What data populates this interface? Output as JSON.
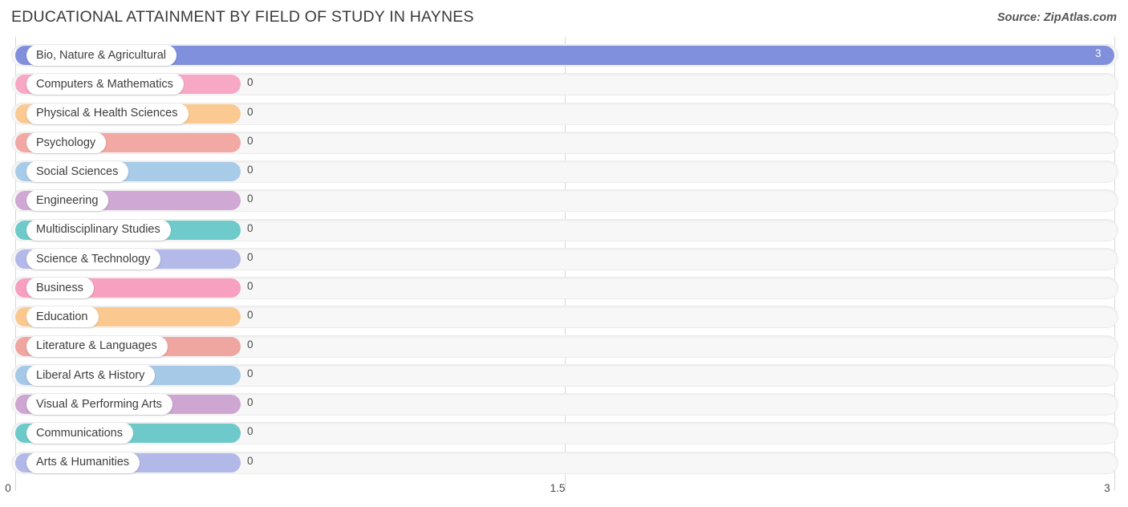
{
  "header": {
    "title": "EDUCATIONAL ATTAINMENT BY FIELD OF STUDY IN HAYNES",
    "source": "Source: ZipAtlas.com"
  },
  "chart_data": {
    "type": "bar",
    "orientation": "horizontal",
    "title": "EDUCATIONAL ATTAINMENT BY FIELD OF STUDY IN HAYNES",
    "xlabel": "",
    "ylabel": "",
    "xlim": [
      0,
      3
    ],
    "grid": true,
    "legend": "none",
    "xticks": [
      "0",
      "1.5",
      "3"
    ],
    "xtick_values": [
      0,
      1.5,
      3
    ],
    "categories": [
      "Bio, Nature & Agricultural",
      "Computers & Mathematics",
      "Physical & Health Sciences",
      "Psychology",
      "Social Sciences",
      "Engineering",
      "Multidisciplinary Studies",
      "Science & Technology",
      "Business",
      "Education",
      "Literature & Languages",
      "Liberal Arts & History",
      "Visual & Performing Arts",
      "Communications",
      "Arts & Humanities"
    ],
    "values": [
      3,
      0,
      0,
      0,
      0,
      0,
      0,
      0,
      0,
      0,
      0,
      0,
      0,
      0,
      0
    ],
    "value_labels": [
      "3",
      "0",
      "0",
      "0",
      "0",
      "0",
      "0",
      "0",
      "0",
      "0",
      "0",
      "0",
      "0",
      "0",
      "0"
    ],
    "colors": [
      "#8190dd",
      "#f7a8c4",
      "#fbc992",
      "#f2a9a3",
      "#a8cbe8",
      "#cfa8d4",
      "#6fcbcb",
      "#b3b9e8",
      "#f7a0c0",
      "#fbc990",
      "#efa6a0",
      "#a7c9e8",
      "#cda6d2",
      "#6ecaca",
      "#b2b8e7"
    ]
  },
  "style": {
    "track_color": "#f7f7f7",
    "gridline_color": "#d8d8d8",
    "title_color": "#3a3a3a"
  }
}
